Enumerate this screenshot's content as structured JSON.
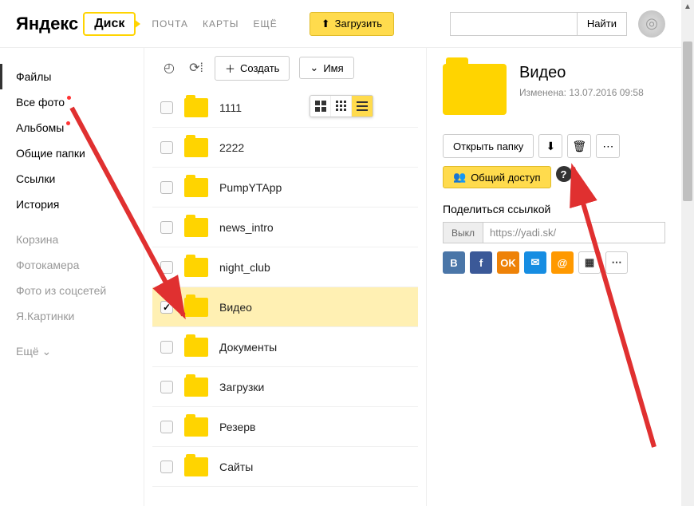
{
  "header": {
    "brand": "Яндекс",
    "service": "Диск",
    "nav": [
      "ПОЧТА",
      "КАРТЫ",
      "ЕЩЁ"
    ],
    "upload": "Загрузить",
    "search_btn": "Найти"
  },
  "sidebar": {
    "primary": [
      {
        "label": "Файлы",
        "key": "files",
        "active": true
      },
      {
        "label": "Все фото",
        "key": "allphoto",
        "dot": true
      },
      {
        "label": "Альбомы",
        "key": "albums",
        "dot": true
      },
      {
        "label": "Общие папки",
        "key": "shared"
      },
      {
        "label": "Ссылки",
        "key": "links"
      },
      {
        "label": "История",
        "key": "history"
      }
    ],
    "secondary": [
      {
        "label": "Корзина",
        "key": "trash"
      },
      {
        "label": "Фотокамера",
        "key": "camera"
      },
      {
        "label": "Фото из соцсетей",
        "key": "socphoto"
      },
      {
        "label": "Я.Картинки",
        "key": "yapics"
      }
    ],
    "more": "Ещё"
  },
  "toolbar": {
    "create": "Создать",
    "sort": "Имя"
  },
  "files": [
    {
      "name": "1111",
      "selected": false
    },
    {
      "name": "2222",
      "selected": false
    },
    {
      "name": "PumpYTApp",
      "selected": false
    },
    {
      "name": "news_intro",
      "selected": false
    },
    {
      "name": "night_club",
      "selected": false
    },
    {
      "name": "Видео",
      "selected": true
    },
    {
      "name": "Документы",
      "selected": false
    },
    {
      "name": "Загрузки",
      "selected": false
    },
    {
      "name": "Резерв",
      "selected": false
    },
    {
      "name": "Сайты",
      "selected": false
    }
  ],
  "detail": {
    "title": "Видео",
    "modified_label": "Изменена:",
    "modified_value": "13.07.2016 09:58",
    "open": "Открыть папку",
    "share_access": "Общий доступ",
    "share_link_label": "Поделиться ссылкой",
    "toggle": "Выкл",
    "link": "https://yadi.sk/"
  },
  "social": [
    {
      "name": "vk",
      "bg": "#4a76a8",
      "txt": "В"
    },
    {
      "name": "fb",
      "bg": "#3b5998",
      "txt": "f"
    },
    {
      "name": "ok",
      "bg": "#ee8208",
      "txt": "OK"
    },
    {
      "name": "mail",
      "bg": "#168de2",
      "txt": "✉"
    },
    {
      "name": "at",
      "bg": "#ff9900",
      "txt": "@"
    },
    {
      "name": "qr",
      "bg": "#fff",
      "txt": "▦"
    },
    {
      "name": "more",
      "bg": "#fff",
      "txt": "⋯"
    }
  ]
}
